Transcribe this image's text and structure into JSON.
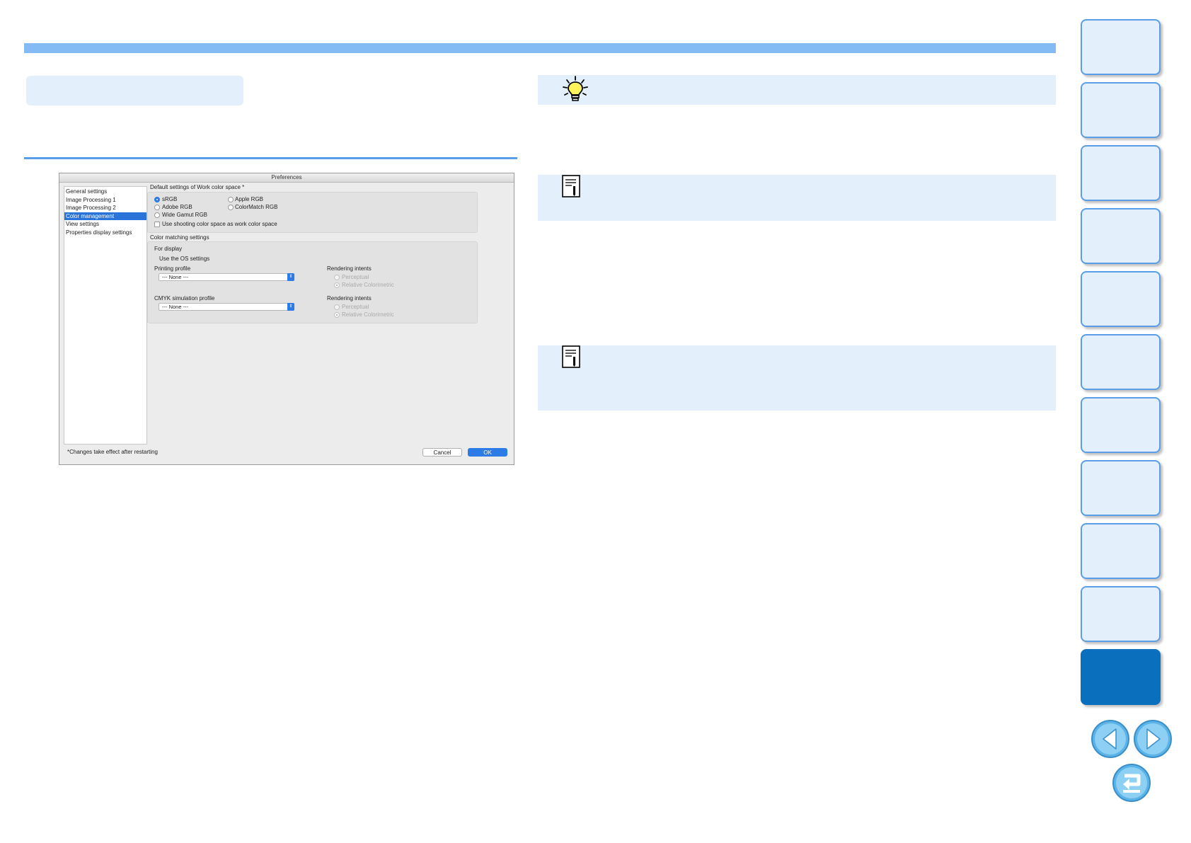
{
  "preferences": {
    "title": "Preferences",
    "sidebar_items": [
      {
        "label": "General settings"
      },
      {
        "label": "Image Processing 1"
      },
      {
        "label": "Image Processing 2"
      },
      {
        "label": "Color management",
        "selected": true
      },
      {
        "label": "View settings"
      },
      {
        "label": "Properties display settings"
      }
    ],
    "work_color_space": {
      "heading": "Default settings of Work color space *",
      "srgb": "sRGB",
      "apple_rgb": "Apple RGB",
      "adobe_rgb": "Adobe RGB",
      "colormatch_rgb": "ColorMatch RGB",
      "wide_gamut_rgb": "Wide Gamut RGB",
      "selected": "sRGB",
      "use_shooting_checkbox": "Use shooting color space as work color space",
      "use_shooting_checked": false
    },
    "color_matching": {
      "heading": "Color matching settings",
      "for_display": "For display",
      "use_os_settings": "Use the OS settings",
      "printing_profile_label": "Printing profile",
      "printing_profile_value": "---   None   ---",
      "printing_rendering_label": "Rendering intents",
      "printing_perceptual": "Perceptual",
      "printing_relative": "Relative Colorimetric",
      "cmyk_profile_label": "CMYK simulation profile",
      "cmyk_profile_value": "---   None   ---",
      "cmyk_rendering_label": "Rendering intents",
      "cmyk_perceptual": "Perceptual",
      "cmyk_relative": "Relative Colorimetric"
    },
    "footer_note": "*Changes take effect after restarting",
    "cancel_label": "Cancel",
    "ok_label": "OK"
  },
  "colors": {
    "accent_blue": "#5a9ee8",
    "panel_bg": "#e3f0fc",
    "active_tab": "#0a6fbd"
  },
  "icons": {
    "tip": "lightbulb-icon",
    "note": "memo-icon",
    "prev": "arrow-left-icon",
    "next": "arrow-right-icon",
    "return": "return-icon"
  }
}
